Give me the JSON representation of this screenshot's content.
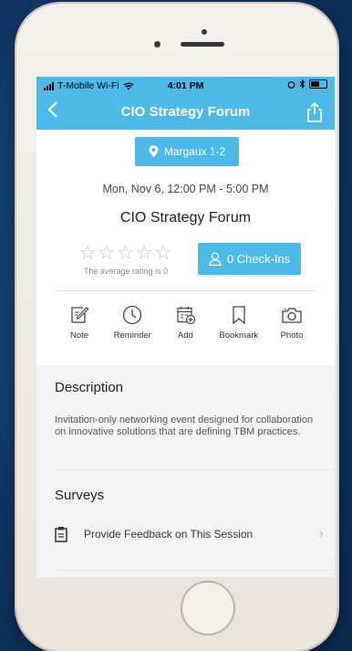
{
  "status_bar": {
    "carrier": "T-Mobile Wi-Fi",
    "time": "4:01 PM"
  },
  "nav": {
    "title": "CIO Strategy Forum",
    "back_icon": "chevron-left-icon",
    "share_icon": "share-icon"
  },
  "session": {
    "location": "Margaux 1-2",
    "datetime": "Mon, Nov 6, 12:00 PM - 5:00 PM",
    "title": "CIO Strategy Forum",
    "rating_caption": "The average rating is 0",
    "average_rating": 0,
    "checkin_label": "0 Check-Ins"
  },
  "actions": [
    {
      "label": "Note",
      "icon": "note-icon"
    },
    {
      "label": "Reminder",
      "icon": "clock-icon"
    },
    {
      "label": "Add",
      "icon": "calendar-add-icon"
    },
    {
      "label": "Bookmark",
      "icon": "bookmark-icon"
    },
    {
      "label": "Photo",
      "icon": "camera-icon"
    }
  ],
  "description": {
    "heading": "Description",
    "text": "Invitation-only networking event designed for collaboration on innovative solutions that are defining TBM practices."
  },
  "surveys": {
    "heading": "Surveys",
    "items": [
      {
        "label": "Provide Feedback on This Session",
        "icon": "clipboard-icon"
      }
    ]
  },
  "colors": {
    "accent": "#4db9e6",
    "background": "#0f3563"
  }
}
